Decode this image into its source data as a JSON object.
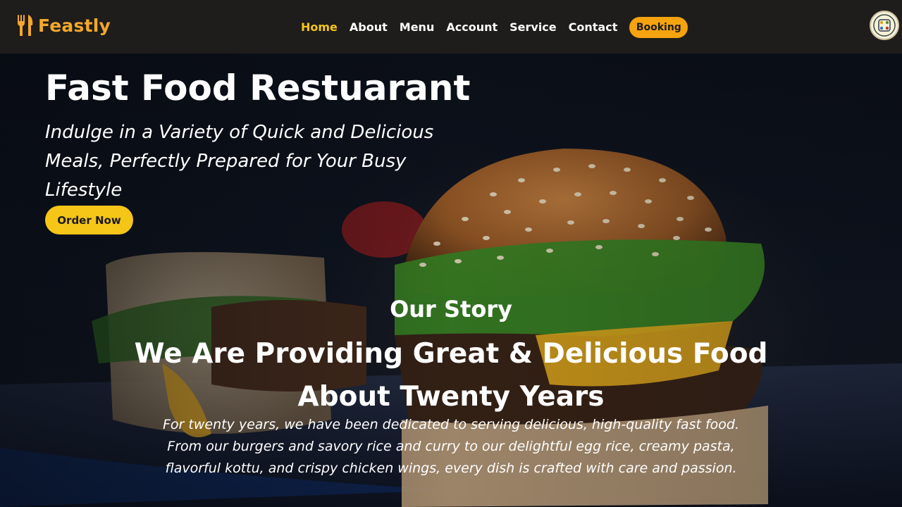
{
  "brand": {
    "name": "Feastly",
    "icon": "fork-knife-icon",
    "color": "#f4a72a"
  },
  "nav": {
    "links": [
      {
        "label": "Home",
        "active": true
      },
      {
        "label": "About",
        "active": false
      },
      {
        "label": "Menu",
        "active": false
      },
      {
        "label": "Account",
        "active": false
      },
      {
        "label": "Service",
        "active": false
      },
      {
        "label": "Contact",
        "active": false
      }
    ],
    "booking_label": "Booking",
    "active_color": "#f5c518",
    "booking_color": "#f5a30f"
  },
  "user": {
    "avatar_icon": "user-avatar-icon"
  },
  "hero": {
    "title": "Fast Food Restuarant",
    "subtitle": "Indulge in a Variety of Quick and Delicious Meals, Perfectly Prepared for Your Busy Lifestyle",
    "order_label": "Order Now",
    "order_color": "#f5c518"
  },
  "story": {
    "eyebrow": "Our Story",
    "title": "We Are Providing Great & Delicious Food About Twenty Years",
    "lines": [
      "For twenty years, we have been dedicated to serving delicious, high-quality fast food.",
      "From our burgers and savory rice and curry to our delightful egg rice, creamy pasta,",
      "flavorful kottu, and crispy chicken wings, every dish is crafted with care and passion."
    ]
  }
}
